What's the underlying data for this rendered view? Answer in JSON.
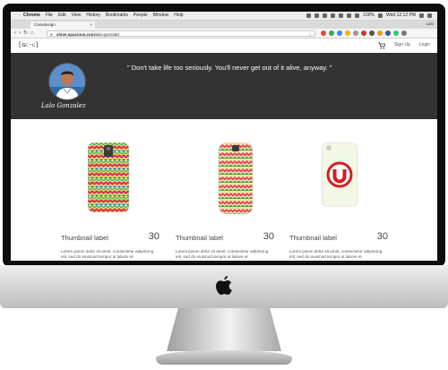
{
  "menubar": {
    "items": [
      "Chrome",
      "File",
      "Edit",
      "View",
      "History",
      "Bookmarks",
      "People",
      "Window",
      "Help"
    ],
    "battery": "100%",
    "clock": "Wed 12:12 PM"
  },
  "browser": {
    "tab_title": "Casedesign",
    "user": "Lalo",
    "url_host": "steve.spacious.com",
    "url_path": "/lalo-gonzalez"
  },
  "site": {
    "brand": "[ɢᴄ-ᴄ]",
    "signup": "Sign Up",
    "login": "Login"
  },
  "profile": {
    "name": "Lalo Gonzalez",
    "quote": "\" Don't take life too seriously. You'll never get out of it alive, anyway. \""
  },
  "products": [
    {
      "label": "Thumbnail label",
      "price": "30",
      "desc": "Lorem ipsum dolor sit amet, consectetur adipiscing elit, sed do eiusmod tempor ut labore et"
    },
    {
      "label": "Thumbnail label",
      "price": "30",
      "desc": "Lorem ipsum dolor sit amet, consectetur adipiscing elit, sed do eiusmod tempor ut labore et"
    },
    {
      "label": "Thumbnail label",
      "price": "30",
      "desc": "Lorem ipsum dolor sit amet, consectetur adipiscing elit, sed do eiusmod tempor ut labore et"
    }
  ],
  "colors": {
    "hero_bg": "#333333",
    "logo_red": "#d21f26",
    "phone_cream": "#f4f8e6"
  }
}
